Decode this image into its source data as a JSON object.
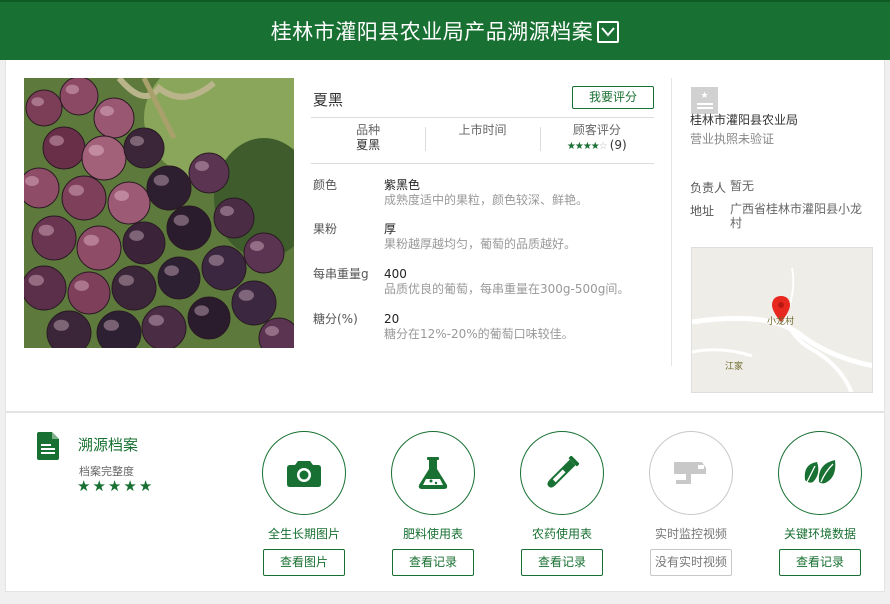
{
  "header": {
    "title": "桂林市灌阳县农业局产品溯源档案",
    "toggle_icon": "chevron-down-icon"
  },
  "product": {
    "name": "夏黑",
    "rate_button": "我要评分",
    "stats": {
      "variety_label": "品种",
      "variety_value": "夏黑",
      "launch_label": "上市时间",
      "launch_value": "",
      "rating_label": "顾客评分",
      "rating_stars": 4,
      "rating_max": 5,
      "rating_count": "(9)"
    },
    "attributes": [
      {
        "label": "颜色",
        "value": "紫黑色",
        "desc": "成熟度适中的果粒，颜色较深、鲜艳。"
      },
      {
        "label": "果粉",
        "value": "厚",
        "desc": "果粉越厚越均匀，葡萄的品质越好。"
      },
      {
        "label": "每串重量g",
        "value": "400",
        "desc": "品质优良的葡萄，每串重量在300g-500g间。"
      },
      {
        "label": "糖分(%)",
        "value": "20",
        "desc": "糖分在12%-20%的葡萄口味较佳。"
      }
    ]
  },
  "organization": {
    "name": "桂林市灌阳县农业局",
    "license": "营业执照未验证",
    "manager_label": "负责人",
    "manager_value": "暂无",
    "address_label": "地址",
    "address_value": "广西省桂林市灌阳县小龙村",
    "map": {
      "village_label": "小龙村",
      "town_label": "江家"
    }
  },
  "trace": {
    "title": "溯源档案",
    "completeness_label": "档案完整度",
    "completeness_stars": 5,
    "records": [
      {
        "icon": "camera-icon",
        "label": "全生长期图片",
        "button": "查看图片",
        "enabled": true
      },
      {
        "icon": "flask-icon",
        "label": "肥料使用表",
        "button": "查看记录",
        "enabled": true
      },
      {
        "icon": "test-tube-icon",
        "label": "农药使用表",
        "button": "查看记录",
        "enabled": true
      },
      {
        "icon": "cctv-camera-icon",
        "label": "实时监控视频",
        "button": "没有实时视频",
        "enabled": false
      },
      {
        "icon": "leaf-icon",
        "label": "关键环境数据",
        "button": "查看记录",
        "enabled": true
      }
    ]
  },
  "colors": {
    "brand": "#187032",
    "muted": "#999999",
    "disabled": "#c8c8c8"
  }
}
